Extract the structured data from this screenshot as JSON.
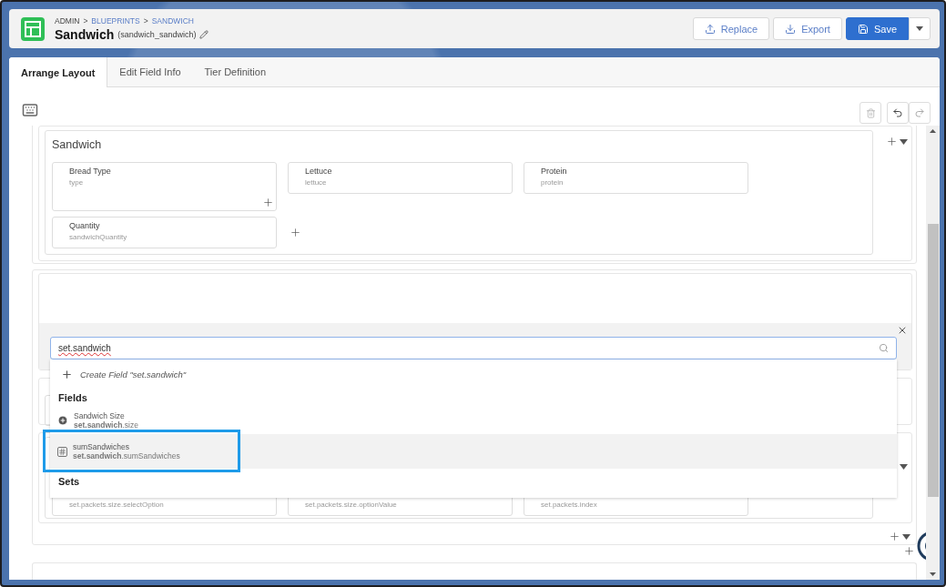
{
  "breadcrumb": {
    "separator": ">",
    "items": [
      {
        "label": "ADMIN",
        "link": false
      },
      {
        "label": "BLUEPRINTS",
        "link": true
      },
      {
        "label": "SANDWICH",
        "link": true
      }
    ]
  },
  "title": "Sandwich",
  "api_name": "(sandwich_sandwich)",
  "actions": [
    {
      "label": "Replace",
      "kind": "upload"
    },
    {
      "label": "Export",
      "kind": "download"
    },
    {
      "label": "Save",
      "kind": "save"
    }
  ],
  "tabs": [
    {
      "label": "Arrange Layout",
      "selected": true
    },
    {
      "label": "Edit Field Info",
      "selected": false
    },
    {
      "label": "Tier Definition",
      "selected": false
    }
  ],
  "section": {
    "title": "Sandwich",
    "fields": [
      {
        "label": "Bread Type",
        "name": "type",
        "tall": true
      },
      {
        "label": "Lettuce",
        "name": "lettuce",
        "tall": false
      },
      {
        "label": "Protein",
        "name": "protein",
        "tall": false
      },
      {
        "label": "Quantity",
        "name": "sandwichQuantity",
        "tall": false
      }
    ]
  },
  "search": {
    "value": "set.sandwich",
    "create_label": "Create Field \"set.sandwich\"",
    "fields_heading": "Fields",
    "items": [
      {
        "label": "Sandwich Size",
        "path": "**set.sandwich**.size",
        "kind": "option",
        "selected": false
      },
      {
        "label": "sumSandwiches",
        "path": "**set.sandwich**.sumSandwiches",
        "kind": "number",
        "selected": true
      }
    ],
    "sets_heading": "Sets"
  },
  "covered_fields": [
    "set.packets.size.selectOption",
    "set.packets.size.optionValue",
    "set.packets.index"
  ]
}
